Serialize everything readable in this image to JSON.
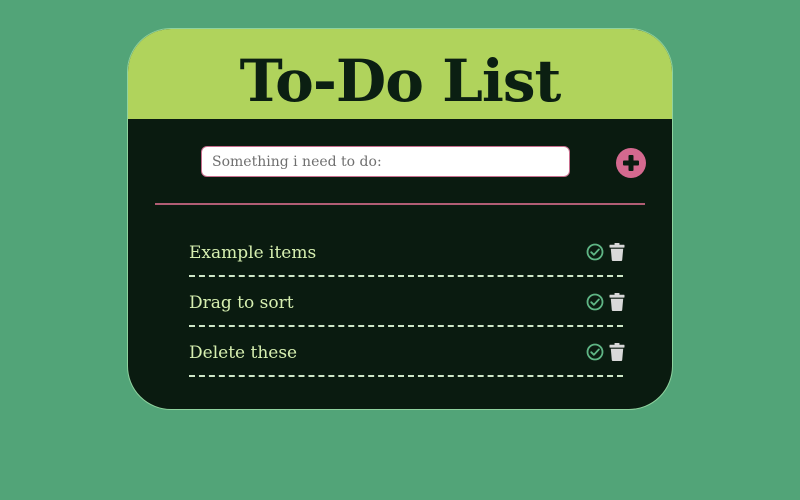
{
  "app": {
    "title": "To-Do List"
  },
  "input": {
    "placeholder": "Something i need to do:",
    "value": ""
  },
  "add_button": {
    "icon": "plus-circle-icon"
  },
  "items": [
    {
      "label": "Example items",
      "complete_icon": "check-circle-icon",
      "delete_icon": "trash-icon"
    },
    {
      "label": "Drag to sort",
      "complete_icon": "check-circle-icon",
      "delete_icon": "trash-icon"
    },
    {
      "label": "Delete these",
      "complete_icon": "check-circle-icon",
      "delete_icon": "trash-icon"
    }
  ],
  "colors": {
    "page_background": "#52a478",
    "header_background": "#b0d35c",
    "card_background": "#0a1b10",
    "accent_pink": "#d4698f",
    "item_text": "#d6efb0",
    "check_icon": "#5fb585",
    "trash_icon": "#d9d9d9"
  }
}
